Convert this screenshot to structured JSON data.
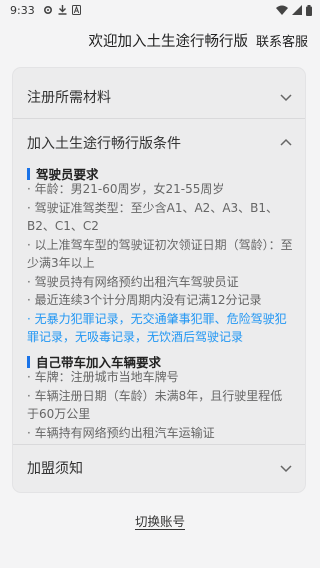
{
  "status_bar": {
    "time": "9:33",
    "icons": [
      "settings-gear-icon",
      "download-icon",
      "app-a-icon"
    ],
    "right_icons": [
      "wifi-icon",
      "signal-icon",
      "battery-icon"
    ]
  },
  "header": {
    "title": "欢迎加入土生途行畅行版",
    "service_label": "联系客服"
  },
  "sections": {
    "materials": {
      "label": "注册所需材料",
      "expanded": false
    },
    "conditions": {
      "label": "加入土生途行畅行版条件",
      "expanded": true
    },
    "notice": {
      "label": "加盟须知",
      "expanded": false
    }
  },
  "driver_requirements": {
    "title": "驾驶员要求",
    "items": [
      "· 年龄：男21-60周岁，女21-55周岁",
      "· 驾驶证准驾类型：至少含A1、A2、A3、B1、B2、C1、C2",
      "· 以上准驾车型的驾驶证初次领证日期（驾龄）：至少满3年以上",
      "· 驾驶员持有网络预约出租汽车驾驶员证",
      "· 最近连续3个计分周期内没有记满12分记录",
      "· 无暴力犯罪记录，无交通肇事犯罪、危险驾驶犯罪记录，无吸毒记录，无饮酒后驾驶记录"
    ]
  },
  "vehicle_requirements": {
    "title": "自己带车加入车辆要求",
    "items": [
      "· 车牌：注册城市当地车牌号",
      "· 车辆注册日期（车龄）未满8年，且行驶里程低于60万公里",
      "· 车辆持有网络预约出租汽车运输证"
    ]
  },
  "footer": {
    "switch_account_label": "切换账号"
  },
  "colors": {
    "accent": "#1a73e8",
    "highlight_text": "#2196f3",
    "background": "#f4f4f5",
    "card": "#ececed"
  }
}
